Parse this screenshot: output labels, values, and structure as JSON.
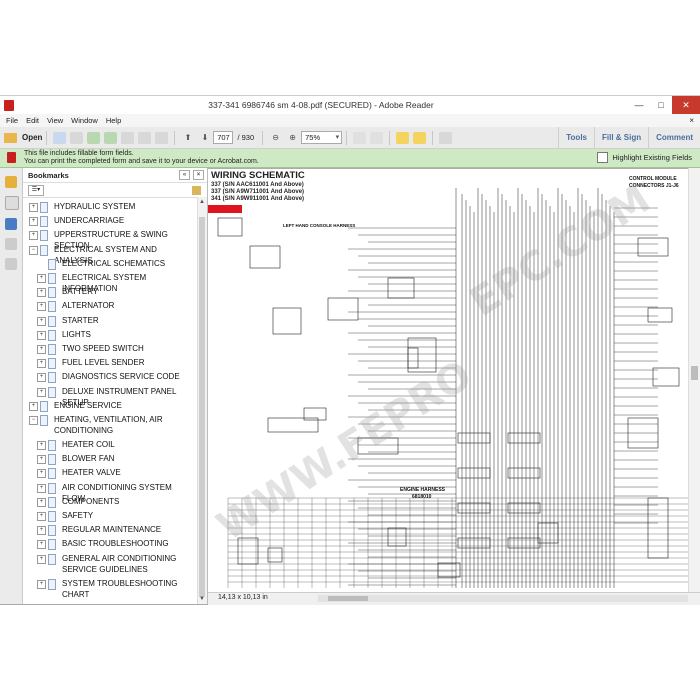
{
  "window": {
    "title": "337-341 6986746 sm 4-08.pdf (SECURED) - Adobe Reader",
    "minimize": "—",
    "maximize": "□",
    "close": "✕"
  },
  "menu": [
    "File",
    "Edit",
    "View",
    "Window",
    "Help"
  ],
  "toolbar": {
    "open_label": "Open",
    "current_page": "707",
    "total_pages": "/ 930",
    "zoom": "75%",
    "tools_label": "Tools",
    "fill_sign_label": "Fill & Sign",
    "comment_label": "Comment"
  },
  "formbar": {
    "line1": "This file includes fillable form fields.",
    "line2": "You can print the completed form and save it to your device or Acrobat.com.",
    "highlight_label": "Highlight Existing Fields"
  },
  "bookmarks": {
    "header": "Bookmarks",
    "items": [
      {
        "label": "HYDRAULIC SYSTEM",
        "expander": "+",
        "level": 0
      },
      {
        "label": "UNDERCARRIAGE",
        "expander": "+",
        "level": 0
      },
      {
        "label": "UPPERSTRUCTURE & SWING SECTION",
        "expander": "+",
        "level": 0
      },
      {
        "label": "ELECTRICAL SYSTEM AND ANALYSIS",
        "expander": "−",
        "level": 0
      },
      {
        "label": "ELECTRICAL SCHEMATICS",
        "expander": "",
        "level": 1
      },
      {
        "label": "ELECTRICAL SYSTEM INFORMATION",
        "expander": "+",
        "level": 1
      },
      {
        "label": "BATTERY",
        "expander": "+",
        "level": 1
      },
      {
        "label": "ALTERNATOR",
        "expander": "+",
        "level": 1
      },
      {
        "label": "STARTER",
        "expander": "+",
        "level": 1
      },
      {
        "label": "LIGHTS",
        "expander": "+",
        "level": 1
      },
      {
        "label": "TWO SPEED SWITCH",
        "expander": "+",
        "level": 1
      },
      {
        "label": "FUEL LEVEL SENDER",
        "expander": "+",
        "level": 1
      },
      {
        "label": "DIAGNOSTICS SERVICE CODE",
        "expander": "+",
        "level": 1
      },
      {
        "label": "DELUXE INSTRUMENT PANEL SETUP",
        "expander": "+",
        "level": 1
      },
      {
        "label": "ENGINE SERVICE",
        "expander": "+",
        "level": 0
      },
      {
        "label": "HEATING, VENTILATION, AIR CONDITIONING",
        "expander": "−",
        "level": 0,
        "wrap": true
      },
      {
        "label": "HEATER COIL",
        "expander": "+",
        "level": 1
      },
      {
        "label": "BLOWER FAN",
        "expander": "+",
        "level": 1
      },
      {
        "label": "HEATER VALVE",
        "expander": "+",
        "level": 1
      },
      {
        "label": "AIR CONDITIONING SYSTEM FLOW",
        "expander": "+",
        "level": 1
      },
      {
        "label": "COMPONENTS",
        "expander": "+",
        "level": 1
      },
      {
        "label": "SAFETY",
        "expander": "+",
        "level": 1
      },
      {
        "label": "REGULAR MAINTENANCE",
        "expander": "+",
        "level": 1
      },
      {
        "label": "BASIC TROUBLESHOOTING",
        "expander": "+",
        "level": 1
      },
      {
        "label": "GENERAL AIR CONDITIONING SERVICE GUIDELINES",
        "expander": "+",
        "level": 1,
        "wrap": true
      },
      {
        "label": "SYSTEM TROUBLESHOOTING CHART",
        "expander": "+",
        "level": 1
      }
    ]
  },
  "document": {
    "title": "WIRING SCHEMATIC",
    "subtitles": [
      "337 (S/N AAC611001 And Above)",
      "337 (S/N A9W711001 And Above)",
      "341 (S/N A9W911001 And Above)"
    ],
    "labels": {
      "control_module": "CONTROL MODULE",
      "connectors": "CONNECTORS J1-J6",
      "left_console": "LEFT HAND CONSOLE HARNESS",
      "engine_harness": "ENGINE HARNESS",
      "engine_harness_no": "6818010"
    }
  },
  "status": {
    "page_size": "14,13 x 10,13 in"
  }
}
